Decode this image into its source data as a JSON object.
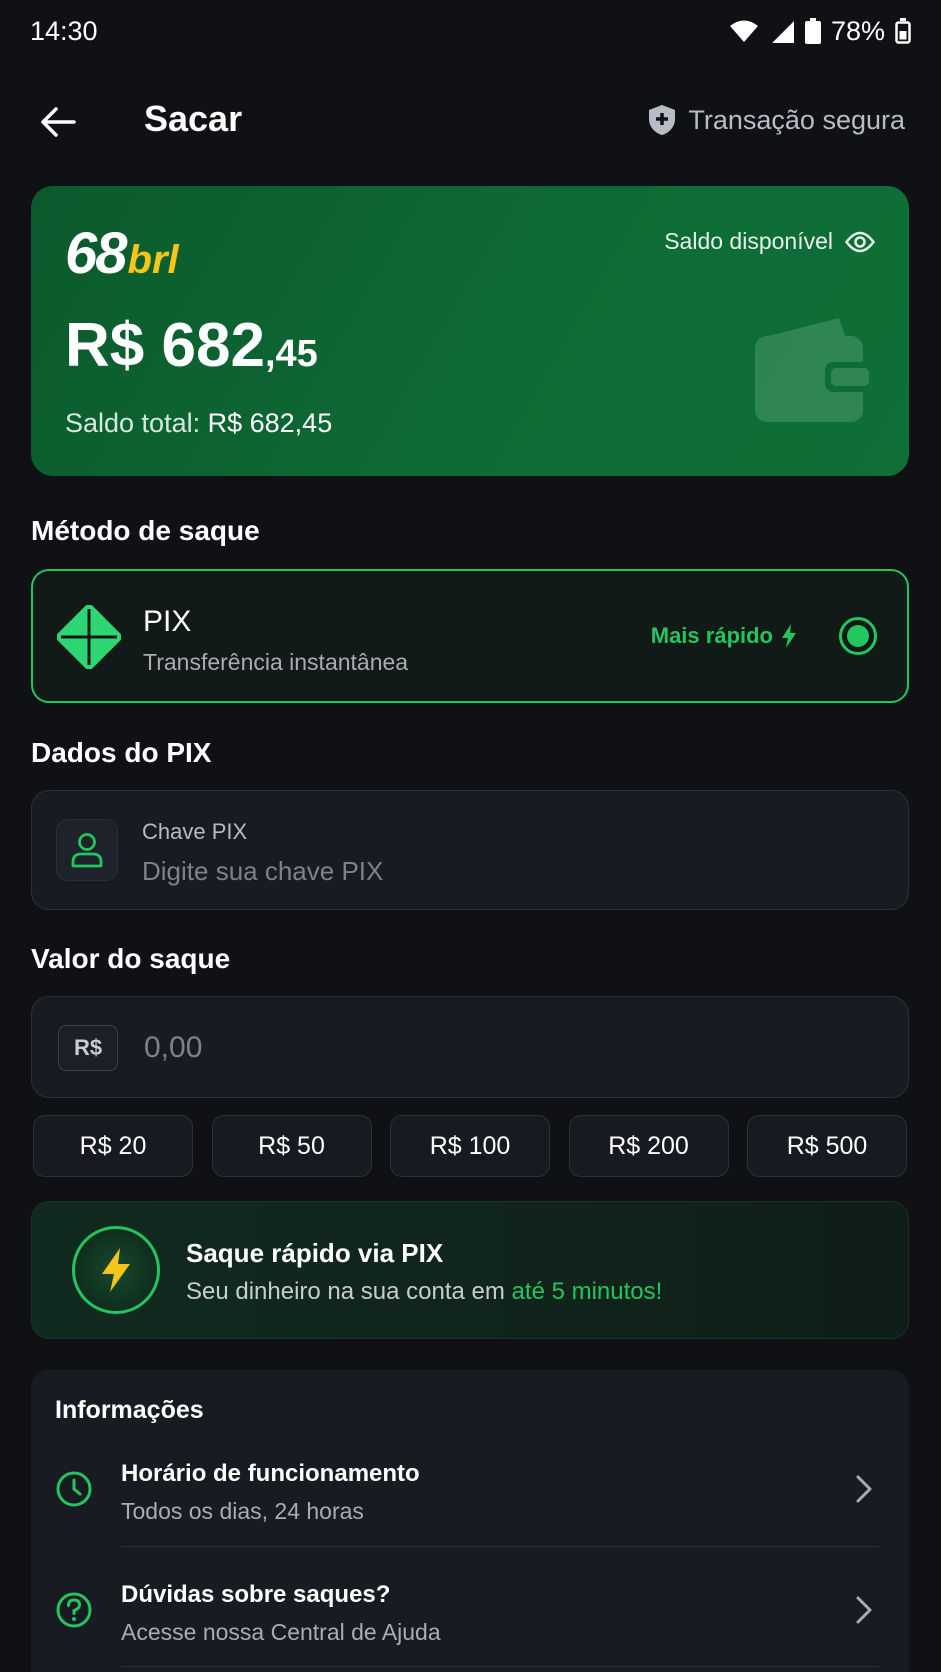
{
  "status_bar": {
    "time": "14:30",
    "battery": "78%"
  },
  "header": {
    "title": "Sacar",
    "secure_label": "Transação segura"
  },
  "balance": {
    "brand_number": "68",
    "brand_suffix": "brl",
    "available_label": "Saldo disponível",
    "amount_main": "R$ 682",
    "amount_cents": ",45",
    "total_label": "Saldo total:",
    "total_value": "R$ 682,45"
  },
  "method": {
    "section_title": "Método de saque",
    "name": "PIX",
    "description": "Transferência instantânea",
    "tag": "Mais rápido"
  },
  "pix_data": {
    "section_title": "Dados do PIX",
    "field_label": "Chave PIX",
    "placeholder": "Digite sua chave PIX"
  },
  "withdraw": {
    "section_title": "Valor do saque",
    "currency": "R$",
    "placeholder": "0,00",
    "quick_amounts": [
      "R$ 20",
      "R$ 50",
      "R$ 100",
      "R$ 200",
      "R$ 500"
    ]
  },
  "banner": {
    "title": "Saque rápido via PIX",
    "desc_prefix": "Seu dinheiro na sua conta em ",
    "desc_highlight": "até 5 minutos!"
  },
  "info": {
    "title": "Informações",
    "items": [
      {
        "title": "Horário de funcionamento",
        "subtitle": "Todos os dias, 24 horas",
        "icon": "clock-icon"
      },
      {
        "title": "Dúvidas sobre saques?",
        "subtitle": "Acesse nossa Central de Ajuda",
        "icon": "help-circle-icon"
      }
    ]
  },
  "colors": {
    "accent": "#22c55e",
    "card_green": "#0e6b35",
    "brand_yellow": "#f5c518",
    "background": "#0f1115"
  }
}
